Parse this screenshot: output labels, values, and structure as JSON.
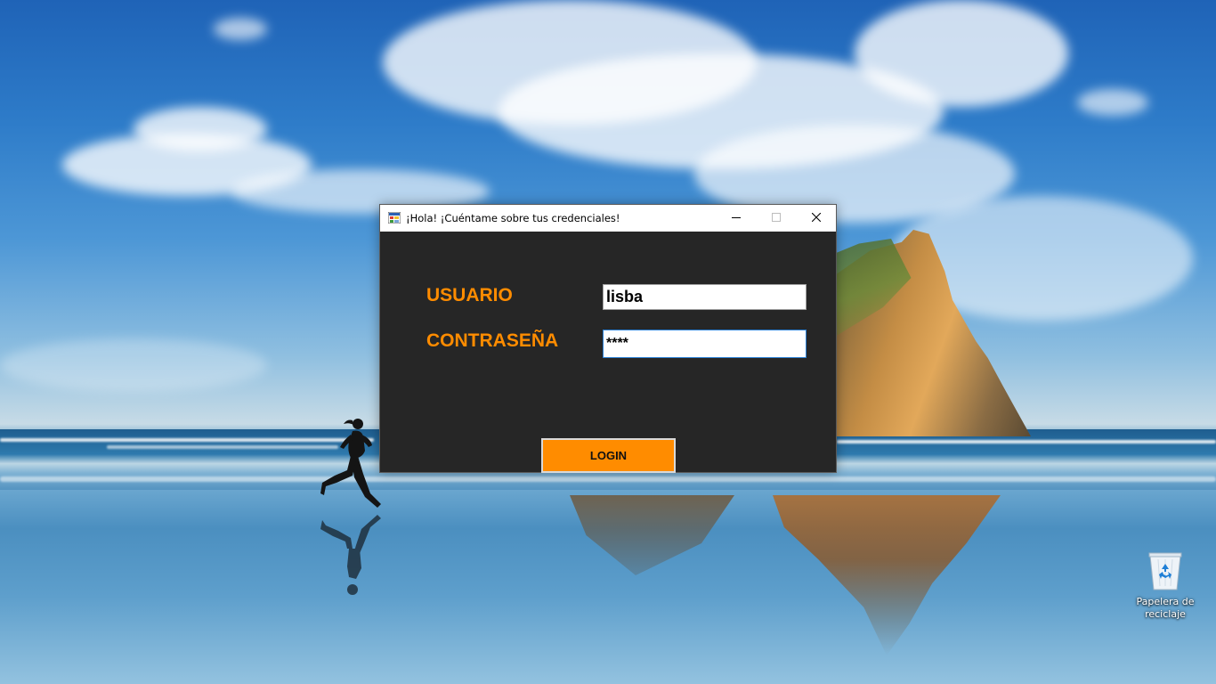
{
  "window": {
    "title": "¡Hola! ¡Cuéntame sobre tus credenciales!",
    "minimize_label": "",
    "maximize_label": "",
    "close_label": ""
  },
  "form": {
    "username_label": "USUARIO",
    "username_value": "lisba",
    "password_label": "CONTRASEÑA",
    "password_value": "****",
    "login_button": "LOGIN"
  },
  "desktop": {
    "recycle_bin_label": "Papelera de reciclaje"
  },
  "colors": {
    "dialog_background": "#262626",
    "accent_orange": "#ff8c00",
    "titlebar": "#ffffff"
  },
  "icons": {
    "app": "form-app-icon",
    "minimize": "minimize-icon",
    "maximize": "maximize-icon",
    "close": "close-icon",
    "recycle_bin": "recycle-bin-icon"
  }
}
